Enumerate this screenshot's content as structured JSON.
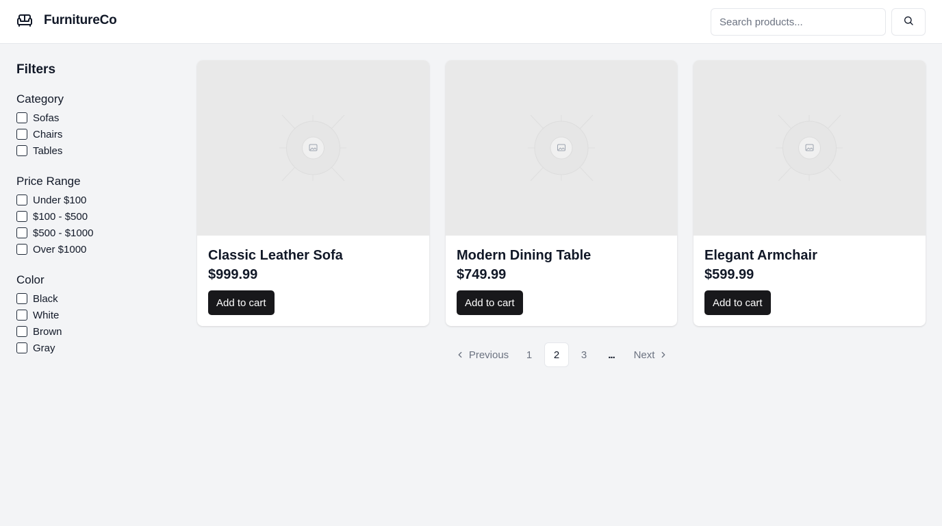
{
  "header": {
    "brand": "FurnitureCo",
    "brand_icon": "sofa-icon",
    "search_placeholder": "Search products...",
    "search_icon": "search-icon"
  },
  "sidebar": {
    "title": "Filters",
    "groups": [
      {
        "title": "Category",
        "options": [
          "Sofas",
          "Chairs",
          "Tables"
        ]
      },
      {
        "title": "Price Range",
        "options": [
          "Under $100",
          "$100 - $500",
          "$500 - $1000",
          "Over $1000"
        ]
      },
      {
        "title": "Color",
        "options": [
          "Black",
          "White",
          "Brown",
          "Gray"
        ]
      }
    ]
  },
  "products": [
    {
      "name": "Classic Leather Sofa",
      "price": "$999.99",
      "button": "Add to cart",
      "image_icon": "image-placeholder-icon"
    },
    {
      "name": "Modern Dining Table",
      "price": "$749.99",
      "button": "Add to cart",
      "image_icon": "image-placeholder-icon"
    },
    {
      "name": "Elegant Armchair",
      "price": "$599.99",
      "button": "Add to cart",
      "image_icon": "image-placeholder-icon"
    }
  ],
  "pagination": {
    "previous": "Previous",
    "pages": [
      "1",
      "2",
      "3"
    ],
    "current": "2",
    "ellipsis": "...",
    "next": "Next"
  },
  "colors": {
    "background": "#f3f4f6",
    "button": "#18181b",
    "image_placeholder": "#e9e9e9"
  }
}
